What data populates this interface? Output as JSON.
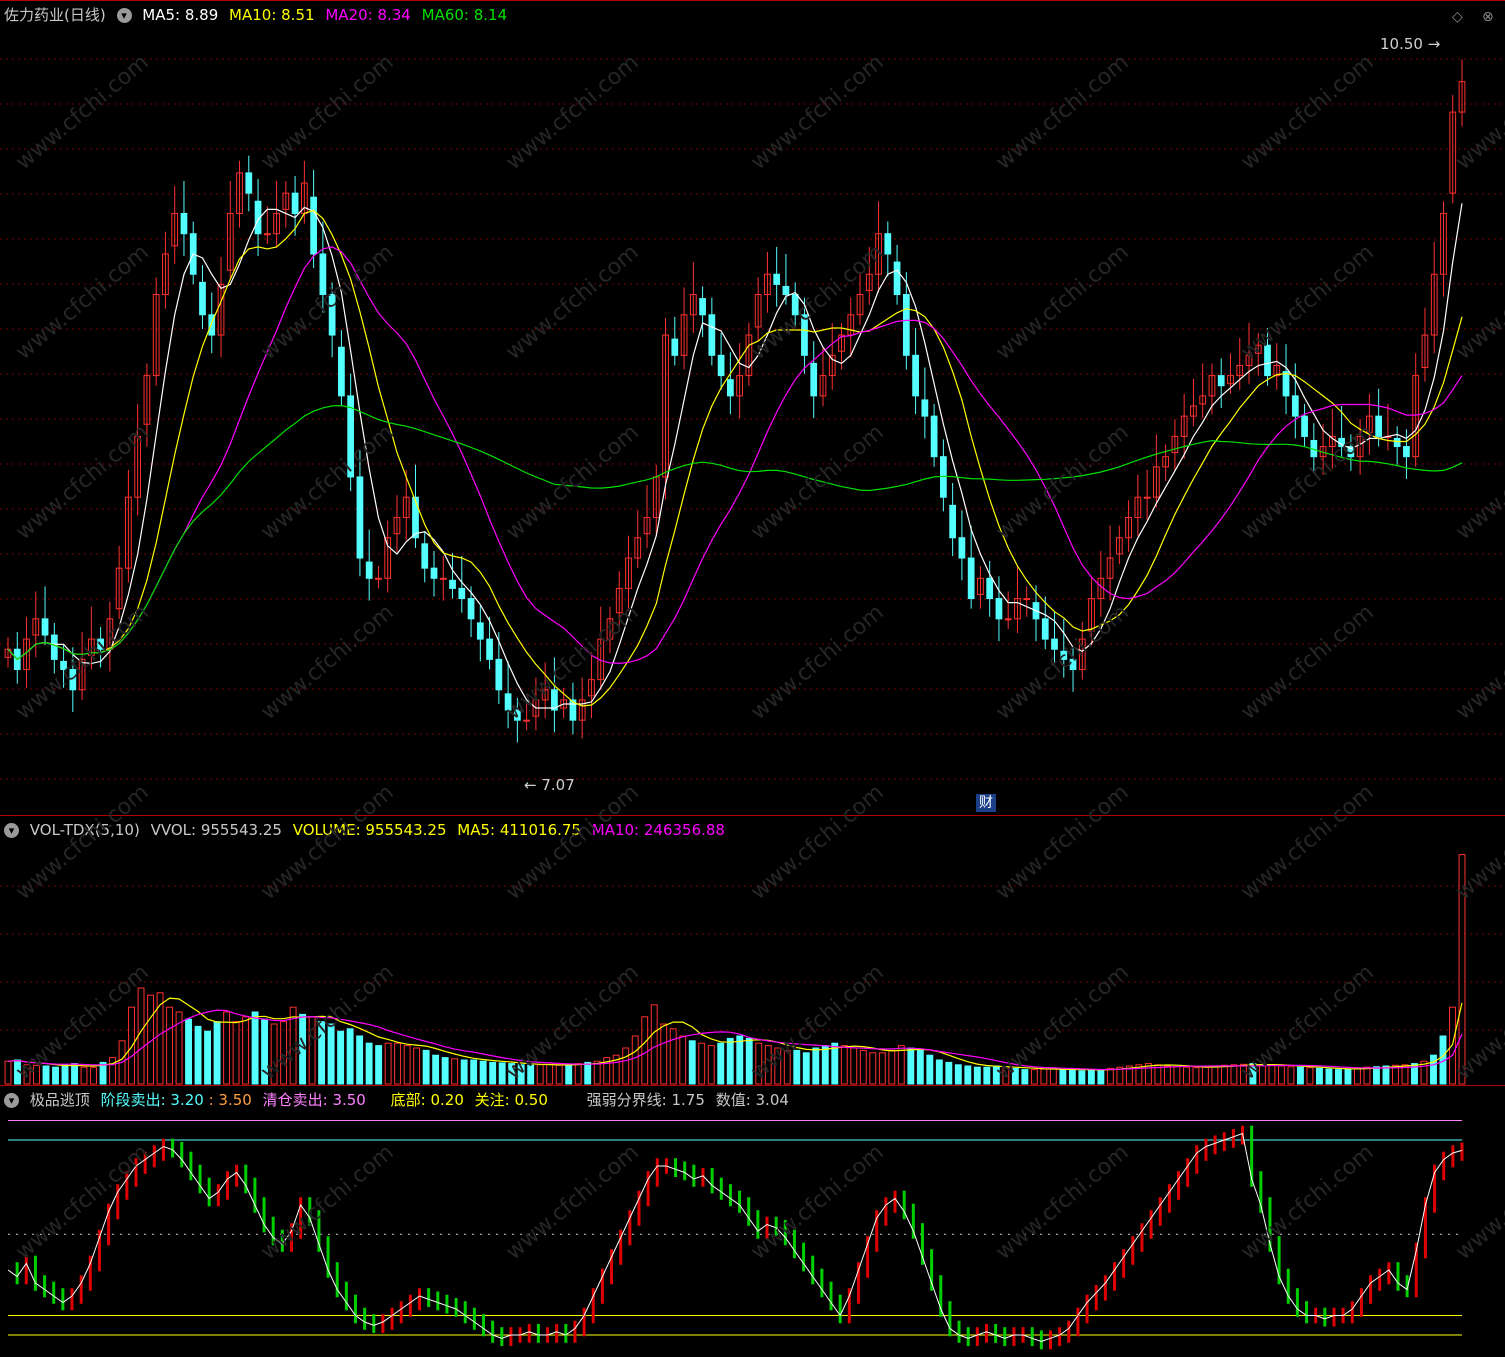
{
  "panel1": {
    "title": "佐力药业(日线)",
    "ma5": "MA5: 8.89",
    "ma10": "MA10: 8.51",
    "ma20": "MA20: 8.34",
    "ma60": "MA60: 8.14",
    "high_label": "10.50",
    "low_label": "7.07",
    "badge": "财",
    "watermark": "www.cfchi.com"
  },
  "panel2": {
    "title": "VOL-TDX(5,10)",
    "vvol": "VVOL: 955543.25",
    "volume": "VOLUME: 955543.25",
    "ma5": "MA5: 411016.75",
    "ma10": "MA10: 246356.88"
  },
  "panel3": {
    "title": "极品逃顶",
    "stage_sell_label": "阶段卖出",
    "stage_sell_a": ": 3.20",
    "stage_sell_b": ": 3.50",
    "clear_sell": "清仓卖出: 3.50",
    "bottom": "底部: 0.20",
    "watch": "关注: 0.50",
    "divide": "强弱分界线: 1.75",
    "value": "数值: 3.04"
  },
  "colors": {
    "up": "#ff3030",
    "down": "#54ffff",
    "ma5": "#ffffff",
    "ma10": "#ffff00",
    "ma20": "#ff00ff",
    "ma60": "#00e000",
    "panel_border": "#b00000"
  },
  "chart_data": [
    {
      "type": "candlestick",
      "title": "佐力药业(日线)",
      "ylim": [
        6.9,
        10.6
      ],
      "closes": [
        7.55,
        7.45,
        7.6,
        7.7,
        7.62,
        7.5,
        7.45,
        7.35,
        7.5,
        7.6,
        7.55,
        7.7,
        7.95,
        8.3,
        8.6,
        8.9,
        9.3,
        9.5,
        9.7,
        9.6,
        9.4,
        9.2,
        9.1,
        9.35,
        9.7,
        9.9,
        9.8,
        9.6,
        9.6,
        9.7,
        9.8,
        9.7,
        9.85,
        9.5,
        9.3,
        9.1,
        8.8,
        8.4,
        8.0,
        7.9,
        7.9,
        8.1,
        8.2,
        8.3,
        8.1,
        7.95,
        7.9,
        7.9,
        7.85,
        7.8,
        7.7,
        7.6,
        7.5,
        7.35,
        7.25,
        7.2,
        7.2,
        7.3,
        7.35,
        7.25,
        7.3,
        7.2,
        7.3,
        7.4,
        7.6,
        7.7,
        7.85,
        8.0,
        8.1,
        8.2,
        8.4,
        9.1,
        9.0,
        9.2,
        9.3,
        9.2,
        9.0,
        8.9,
        8.8,
        8.9,
        9.1,
        9.3,
        9.4,
        9.35,
        9.3,
        9.2,
        9.0,
        8.8,
        8.9,
        9.0,
        9.1,
        9.2,
        9.3,
        9.4,
        9.6,
        9.5,
        9.3,
        9.0,
        8.8,
        8.7,
        8.5,
        8.3,
        8.1,
        8.0,
        7.8,
        7.9,
        7.8,
        7.7,
        7.7,
        7.8,
        7.8,
        7.7,
        7.6,
        7.55,
        7.5,
        7.45,
        7.6,
        7.8,
        7.9,
        8.0,
        8.1,
        8.2,
        8.3,
        8.3,
        8.45,
        8.5,
        8.6,
        8.7,
        8.75,
        8.8,
        8.9,
        8.85,
        8.9,
        8.95,
        9.0,
        9.05,
        8.9,
        8.95,
        8.8,
        8.7,
        8.6,
        8.5,
        8.55,
        8.6,
        8.55,
        8.5,
        8.6,
        8.7,
        8.6,
        8.6,
        8.55,
        8.5,
        8.9,
        9.1,
        9.4,
        9.7,
        10.2,
        10.35
      ]
    },
    {
      "type": "bar",
      "title": "VOL-TDX(5,10)",
      "ylim": [
        0,
        1000000
      ],
      "values": [
        95000,
        100000,
        80000,
        78000,
        75000,
        70000,
        80000,
        85000,
        70000,
        68000,
        90000,
        110000,
        180000,
        320000,
        400000,
        370000,
        380000,
        320000,
        300000,
        270000,
        240000,
        220000,
        260000,
        300000,
        260000,
        280000,
        300000,
        270000,
        250000,
        260000,
        320000,
        290000,
        280000,
        260000,
        250000,
        220000,
        230000,
        200000,
        170000,
        160000,
        170000,
        170000,
        160000,
        150000,
        140000,
        120000,
        110000,
        105000,
        100000,
        100000,
        95000,
        90000,
        88000,
        85000,
        80000,
        78000,
        80000,
        82000,
        78000,
        80000,
        85000,
        90000,
        95000,
        110000,
        120000,
        150000,
        200000,
        280000,
        330000,
        250000,
        230000,
        200000,
        180000,
        170000,
        160000,
        170000,
        190000,
        200000,
        190000,
        170000,
        160000,
        150000,
        140000,
        140000,
        130000,
        150000,
        160000,
        170000,
        160000,
        150000,
        140000,
        130000,
        130000,
        140000,
        160000,
        150000,
        140000,
        120000,
        100000,
        90000,
        80000,
        75000,
        70000,
        70000,
        75000,
        70000,
        65000,
        60000,
        60000,
        62000,
        65000,
        60000,
        58000,
        55000,
        60000,
        60000,
        65000,
        70000,
        75000,
        80000,
        85000,
        80000,
        75000,
        72000,
        70000,
        68000,
        70000,
        75000,
        78000,
        80000,
        82000,
        85000,
        80000,
        78000,
        75000,
        72000,
        70000,
        68000,
        65000,
        62000,
        60000,
        62000,
        65000,
        70000,
        72000,
        75000,
        78000,
        80000,
        85000,
        95000,
        120000,
        200000,
        320000,
        955543
      ]
    },
    {
      "type": "line",
      "title": "极品逃顶",
      "ylim": [
        0,
        3.6
      ],
      "reference_lines": {
        "阶段卖出": 3.2,
        "清仓卖出": 3.5,
        "强弱分界线": 1.75,
        "关注": 0.5,
        "底部": 0.2
      },
      "values": [
        1.2,
        1.1,
        1.3,
        1.0,
        0.9,
        0.8,
        0.7,
        0.8,
        1.0,
        1.3,
        1.7,
        2.1,
        2.4,
        2.6,
        2.8,
        2.9,
        3.0,
        3.1,
        3.05,
        2.9,
        2.7,
        2.5,
        2.3,
        2.4,
        2.6,
        2.7,
        2.5,
        2.2,
        1.9,
        1.7,
        1.6,
        1.8,
        2.2,
        2.0,
        1.6,
        1.2,
        0.9,
        0.7,
        0.5,
        0.4,
        0.35,
        0.4,
        0.5,
        0.6,
        0.7,
        0.8,
        0.75,
        0.7,
        0.65,
        0.6,
        0.5,
        0.4,
        0.3,
        0.2,
        0.15,
        0.2,
        0.2,
        0.25,
        0.2,
        0.2,
        0.25,
        0.2,
        0.3,
        0.5,
        0.8,
        1.1,
        1.4,
        1.7,
        2.0,
        2.3,
        2.6,
        2.8,
        2.8,
        2.75,
        2.7,
        2.6,
        2.65,
        2.5,
        2.4,
        2.3,
        2.2,
        2.0,
        1.8,
        1.9,
        1.85,
        1.7,
        1.5,
        1.3,
        1.1,
        0.9,
        0.7,
        0.5,
        0.8,
        1.2,
        1.6,
        2.0,
        2.2,
        2.3,
        2.1,
        1.8,
        1.4,
        1.0,
        0.6,
        0.3,
        0.2,
        0.15,
        0.2,
        0.25,
        0.2,
        0.15,
        0.2,
        0.2,
        0.15,
        0.1,
        0.15,
        0.2,
        0.3,
        0.5,
        0.7,
        0.85,
        1.0,
        1.2,
        1.4,
        1.6,
        1.8,
        2.0,
        2.2,
        2.4,
        2.6,
        2.8,
        3.0,
        3.1,
        3.15,
        3.2,
        3.25,
        3.3,
        2.6,
        2.2,
        1.6,
        1.1,
        0.8,
        0.6,
        0.5,
        0.5,
        0.45,
        0.5,
        0.5,
        0.6,
        0.8,
        1.0,
        1.1,
        1.2,
        1.0,
        0.9,
        1.5,
        2.2,
        2.7,
        2.9,
        3.0,
        3.04
      ]
    }
  ]
}
